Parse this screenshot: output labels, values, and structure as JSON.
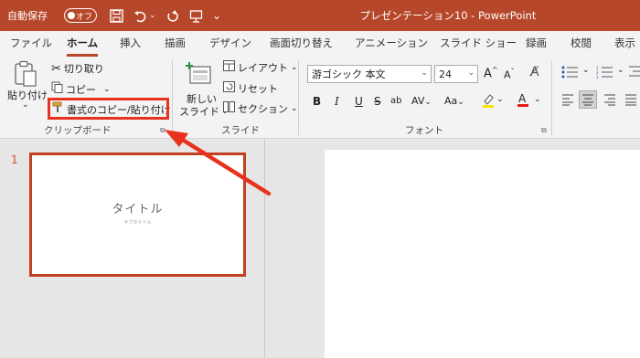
{
  "titlebar": {
    "autosave_label": "自動保存",
    "toggle_label": "オフ",
    "doc_title": "プレゼンテーション10 - PowerPoint",
    "icons": [
      "save-icon",
      "undo-icon",
      "redo-icon",
      "present-icon"
    ]
  },
  "tabs": [
    "ファイル",
    "ホーム",
    "挿入",
    "描画",
    "デザイン",
    "画面切り替え",
    "アニメーション",
    "スライド ショー",
    "録画",
    "校閲",
    "表示"
  ],
  "active_tab": "ホーム",
  "ribbon": {
    "clipboard": {
      "paste_label": "貼り付け",
      "cut_label": "切り取り",
      "copy_label": "コピー",
      "format_painter_label": "書式のコピー/貼り付け",
      "group_label": "クリップボード"
    },
    "slides": {
      "new_slide_line1": "新しい",
      "new_slide_line2": "スライド",
      "layout_label": "レイアウト",
      "reset_label": "リセット",
      "section_label": "セクション",
      "group_label": "スライド"
    },
    "font": {
      "font_name": "游ゴシック 本文",
      "font_size": "24",
      "bold": "B",
      "italic": "I",
      "underline": "U",
      "strike": "S",
      "shadow": "ab",
      "spacing": "AV",
      "case": "Aa",
      "grow": "A",
      "shrink": "A",
      "group_label": "フォント"
    }
  },
  "slide_panel": {
    "slide_number": "1",
    "thumb_title": "タイトル",
    "thumb_subtitle": "サブタイトル"
  },
  "colors": {
    "accent": "#b7472a",
    "annotation": "#e8321e"
  }
}
